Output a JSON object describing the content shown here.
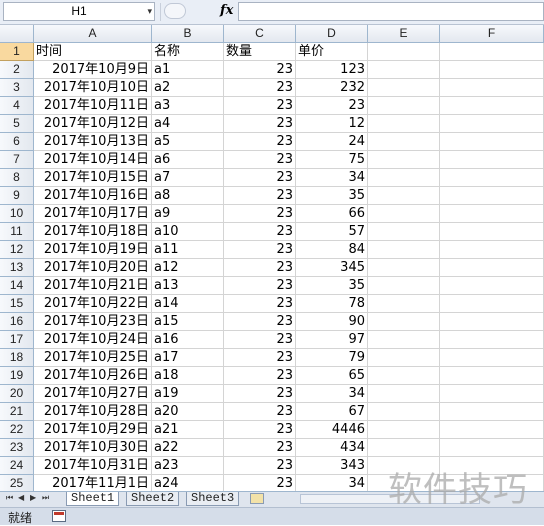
{
  "namebox": {
    "value": "H1",
    "arrow": "▾"
  },
  "formula": {
    "fx_label": "fx",
    "value": ""
  },
  "columns": [
    "A",
    "B",
    "C",
    "D",
    "E",
    "F"
  ],
  "rows": [
    {
      "n": "1",
      "a": "时间",
      "b": "名称",
      "c": "数量",
      "d": "单价"
    },
    {
      "n": "2",
      "a": "2017年10月9日",
      "b": "a1",
      "c": "23",
      "d": "123"
    },
    {
      "n": "3",
      "a": "2017年10月10日",
      "b": "a2",
      "c": "23",
      "d": "232"
    },
    {
      "n": "4",
      "a": "2017年10月11日",
      "b": "a3",
      "c": "23",
      "d": "23"
    },
    {
      "n": "5",
      "a": "2017年10月12日",
      "b": "a4",
      "c": "23",
      "d": "12"
    },
    {
      "n": "6",
      "a": "2017年10月13日",
      "b": "a5",
      "c": "23",
      "d": "24"
    },
    {
      "n": "7",
      "a": "2017年10月14日",
      "b": "a6",
      "c": "23",
      "d": "75"
    },
    {
      "n": "8",
      "a": "2017年10月15日",
      "b": "a7",
      "c": "23",
      "d": "34"
    },
    {
      "n": "9",
      "a": "2017年10月16日",
      "b": "a8",
      "c": "23",
      "d": "35"
    },
    {
      "n": "10",
      "a": "2017年10月17日",
      "b": "a9",
      "c": "23",
      "d": "66"
    },
    {
      "n": "11",
      "a": "2017年10月18日",
      "b": "a10",
      "c": "23",
      "d": "57"
    },
    {
      "n": "12",
      "a": "2017年10月19日",
      "b": "a11",
      "c": "23",
      "d": "84"
    },
    {
      "n": "13",
      "a": "2017年10月20日",
      "b": "a12",
      "c": "23",
      "d": "345"
    },
    {
      "n": "14",
      "a": "2017年10月21日",
      "b": "a13",
      "c": "23",
      "d": "35"
    },
    {
      "n": "15",
      "a": "2017年10月22日",
      "b": "a14",
      "c": "23",
      "d": "78"
    },
    {
      "n": "16",
      "a": "2017年10月23日",
      "b": "a15",
      "c": "23",
      "d": "90"
    },
    {
      "n": "17",
      "a": "2017年10月24日",
      "b": "a16",
      "c": "23",
      "d": "97"
    },
    {
      "n": "18",
      "a": "2017年10月25日",
      "b": "a17",
      "c": "23",
      "d": "79"
    },
    {
      "n": "19",
      "a": "2017年10月26日",
      "b": "a18",
      "c": "23",
      "d": "65"
    },
    {
      "n": "20",
      "a": "2017年10月27日",
      "b": "a19",
      "c": "23",
      "d": "34"
    },
    {
      "n": "21",
      "a": "2017年10月28日",
      "b": "a20",
      "c": "23",
      "d": "67"
    },
    {
      "n": "22",
      "a": "2017年10月29日",
      "b": "a21",
      "c": "23",
      "d": "4446"
    },
    {
      "n": "23",
      "a": "2017年10月30日",
      "b": "a22",
      "c": "23",
      "d": "434"
    },
    {
      "n": "24",
      "a": "2017年10月31日",
      "b": "a23",
      "c": "23",
      "d": "343"
    },
    {
      "n": "25",
      "a": "2017年11月1日",
      "b": "a24",
      "c": "23",
      "d": "34"
    }
  ],
  "selected_row": "1",
  "sheet_nav": [
    "⏮",
    "◀",
    "▶",
    "⏭"
  ],
  "sheets": [
    "Sheet1",
    "Sheet2",
    "Sheet3"
  ],
  "active_sheet": "Sheet1",
  "status": {
    "text": "就绪"
  },
  "watermark": "软件技巧"
}
